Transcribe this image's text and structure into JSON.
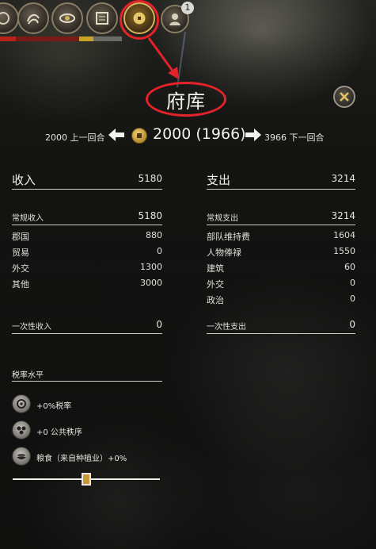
{
  "topbar": {
    "buttons": [
      {
        "icon": "faction-icon"
      },
      {
        "icon": "swirl-icon"
      },
      {
        "icon": "eye-icon"
      },
      {
        "icon": "scroll-book-icon"
      },
      {
        "icon": "treasury-coin-icon",
        "selected": true
      },
      {
        "icon": "character-portrait-icon"
      }
    ],
    "badge_count": "1"
  },
  "title": "府库",
  "turn": {
    "prev_value": "2000",
    "prev_label": "上一回合",
    "current": "2000 (1966)",
    "next_value": "3966",
    "next_label": "下一回合"
  },
  "income": {
    "header_label": "收入",
    "header_value": "5180",
    "regular_label": "常规收入",
    "regular_value": "5180",
    "items": [
      {
        "label": "郡国",
        "value": "880"
      },
      {
        "label": "贸易",
        "value": "0"
      },
      {
        "label": "外交",
        "value": "1300"
      },
      {
        "label": "其他",
        "value": "3000"
      }
    ],
    "onetime_label": "一次性收入",
    "onetime_value": "0"
  },
  "expense": {
    "header_label": "支出",
    "header_value": "3214",
    "regular_label": "常规支出",
    "regular_value": "3214",
    "items": [
      {
        "label": "部队维持费",
        "value": "1604"
      },
      {
        "label": "人物俸禄",
        "value": "1550"
      },
      {
        "label": "建筑",
        "value": "60"
      },
      {
        "label": "外交",
        "value": "0"
      },
      {
        "label": "政治",
        "value": "0"
      }
    ],
    "onetime_label": "一次性支出",
    "onetime_value": "0"
  },
  "tax": {
    "header": "税率水平",
    "effects": [
      {
        "icon": "tax-rate-icon",
        "text": "+0%税率"
      },
      {
        "icon": "public-order-icon",
        "text": "+0 公共秩序"
      },
      {
        "icon": "food-icon",
        "text": "粮食（来自种植业）+0%"
      }
    ],
    "slider_level": 0.5
  },
  "colors": {
    "highlight_red": "#e2232a",
    "gold": "#c49a3a"
  }
}
